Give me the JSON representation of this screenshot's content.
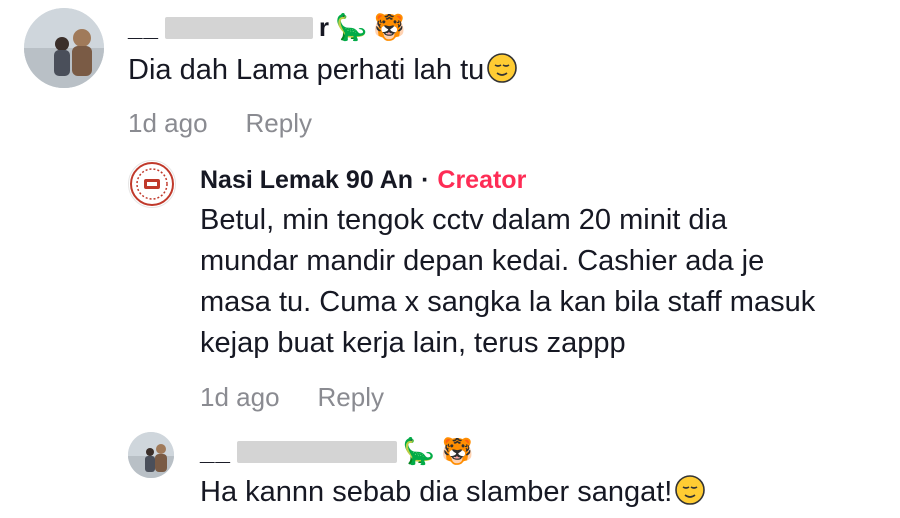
{
  "comments": [
    {
      "username_prefix": "__",
      "username_suffix": "r",
      "badges": [
        "dinosaur-icon",
        "cat-face-icon"
      ],
      "text": "Dia dah Lama perhati lah tu",
      "trailing_emoji": "relieved-face-icon",
      "timestamp": "1d ago",
      "reply_label": "Reply"
    },
    {
      "username": "Nasi Lemak 90 An",
      "separator": "·",
      "creator_label": "Creator",
      "text_lines": [
        "Betul, min tengok cctv dalam 20 minit dia",
        "mundar mandir depan kedai. Cashier ada je",
        "masa tu. Cuma x sangka la kan bila staff masuk",
        "kejap buat kerja lain, terus zappp"
      ],
      "timestamp": "1d ago",
      "reply_label": "Reply"
    },
    {
      "username_prefix": "__",
      "badges": [
        "dinosaur-icon",
        "cat-face-icon"
      ],
      "text": "Ha kannn sebab dia slamber sangat!",
      "trailing_emoji": "relieved-face-icon"
    }
  ],
  "colors": {
    "text": "#161823",
    "meta": "#8a8b91",
    "creator": "#fe2c55",
    "redaction": "#d4d4d4"
  }
}
